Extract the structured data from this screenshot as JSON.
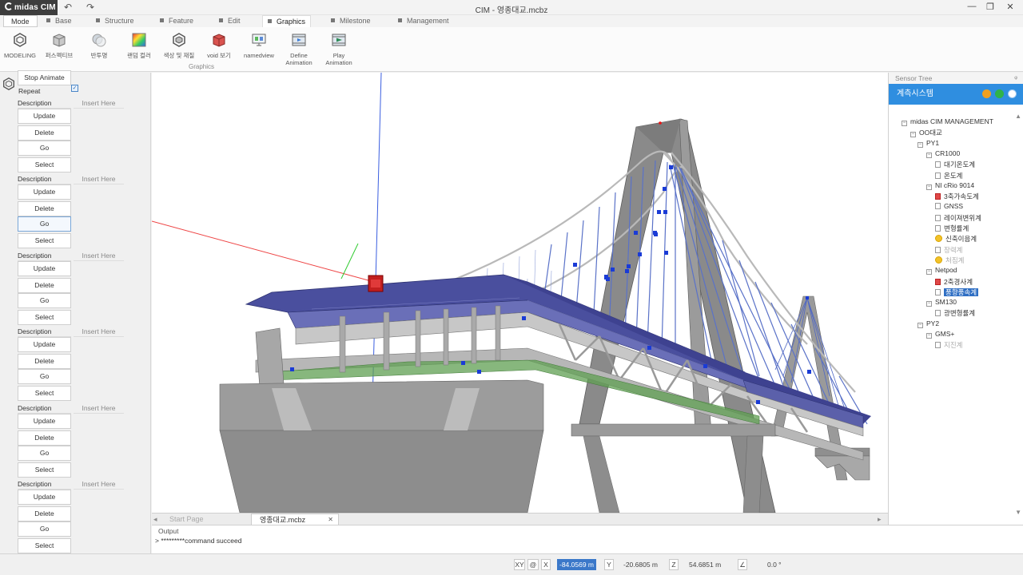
{
  "window": {
    "title": "CIM - 영종대교.mcbz",
    "logo": "midas CIM",
    "undo_glyph": "↶",
    "redo_glyph": "↷",
    "minimize_glyph": "—",
    "restore_glyph": "❐",
    "close_glyph": "✕"
  },
  "menu_tabs": [
    {
      "label": "Mode"
    },
    {
      "label": "Base"
    },
    {
      "label": "Structure"
    },
    {
      "label": "Feature"
    },
    {
      "label": "Edit"
    },
    {
      "label": "Graphics"
    },
    {
      "label": "Milestone"
    },
    {
      "label": "Management"
    }
  ],
  "ribbon": {
    "group_label": "Graphics",
    "buttons": [
      {
        "label": "MODELING",
        "icon": "modeling-icon"
      },
      {
        "label": "퍼스펙티브",
        "icon": "perspective-icon"
      },
      {
        "label": "반투명",
        "icon": "translucent-icon"
      },
      {
        "label": "랜덤 컬러",
        "icon": "random-color-icon"
      },
      {
        "label": "색상 및 재질",
        "icon": "color-material-icon"
      },
      {
        "label": "void 보기",
        "icon": "void-view-icon"
      },
      {
        "label": "namedview",
        "icon": "namedview-icon"
      },
      {
        "label": "Define Animation",
        "icon": "define-animation-icon"
      },
      {
        "label": "Play Animation",
        "icon": "play-animation-icon"
      }
    ]
  },
  "left_panel": {
    "stop_animate": "Stop Animate",
    "repeat_label": "Repeat",
    "repeat_checked": true,
    "check_glyph": "✓",
    "blocks": [
      {
        "description": "Description",
        "insert": "Insert Here",
        "update": "Update",
        "delete": "Delete",
        "go": "Go",
        "select": "Select"
      },
      {
        "description": "Description",
        "insert": "Insert Here",
        "update": "Update",
        "delete": "Delete",
        "go": "Go",
        "select": "Select"
      },
      {
        "description": "Description",
        "insert": "Insert Here",
        "update": "Update",
        "delete": "Delete",
        "go": "Go",
        "select": "Select"
      },
      {
        "description": "Description",
        "insert": "Insert Here",
        "update": "Update",
        "delete": "Delete",
        "go": "Go",
        "select": "Select"
      },
      {
        "description": "Description",
        "insert": "Insert Here",
        "update": "Update",
        "delete": "Delete",
        "go": "Go",
        "select": "Select"
      },
      {
        "description": "Description",
        "insert": "Insert Here",
        "update": "Update",
        "delete": "Delete",
        "go": "Go",
        "select": "Select"
      }
    ]
  },
  "doc_tabs": {
    "prev_glyph": "◂",
    "next_glyph": "▸",
    "close_glyph": "✕",
    "start": "Start Page",
    "active": "영종대교.mcbz"
  },
  "output": {
    "title": "Output",
    "line": "> *********command succeed"
  },
  "sensor_tree": {
    "header": "Sensor Tree",
    "pin_glyph": "ᵠ",
    "bar_title": "계측시스템",
    "scroll_up": "▲",
    "scroll_down": "▼",
    "nodes": [
      {
        "label": "midas CIM MANAGEMENT",
        "kind": "exp"
      },
      {
        "label": "OO대교",
        "kind": "exp"
      },
      {
        "label": "PY1",
        "kind": "exp"
      },
      {
        "label": "CR1000",
        "kind": "exp"
      },
      {
        "label": "대기온도계",
        "kind": "doc"
      },
      {
        "label": "온도계",
        "kind": "doc"
      },
      {
        "label": "NI cRio 9014",
        "kind": "exp"
      },
      {
        "label": "3축가속도계",
        "kind": "red"
      },
      {
        "label": "GNSS",
        "kind": "doc"
      },
      {
        "label": "레이져변위계",
        "kind": "doc"
      },
      {
        "label": "변형률계",
        "kind": "doc"
      },
      {
        "label": "신축이음계",
        "kind": "yel"
      },
      {
        "label": "장력계",
        "kind": "doc-dim"
      },
      {
        "label": "처짐계",
        "kind": "yel-dim"
      },
      {
        "label": "Netpod",
        "kind": "exp"
      },
      {
        "label": "2축경사계",
        "kind": "red"
      },
      {
        "label": "풍향풍속계",
        "kind": "sel"
      },
      {
        "label": "SM130",
        "kind": "exp"
      },
      {
        "label": "광변형률계",
        "kind": "doc"
      },
      {
        "label": "PY2",
        "kind": "exp"
      },
      {
        "label": "GMS+",
        "kind": "exp"
      },
      {
        "label": "지진계",
        "kind": "doc-dim"
      }
    ]
  },
  "status": {
    "xy": "XY",
    "at": "@",
    "x_label": "X",
    "x_value": "-84.0569 m",
    "y_label": "Y",
    "y_value": "-20.6805 m",
    "z_label": "Z",
    "z_value": "54.6851 m",
    "angle_glyph": "∠",
    "angle_value": "0.0 °"
  },
  "colors": {
    "accent": "#2f8ee0",
    "deck": "#4a4f9e",
    "pylon": "#8b8b8b",
    "cable": "#5a72c8"
  }
}
